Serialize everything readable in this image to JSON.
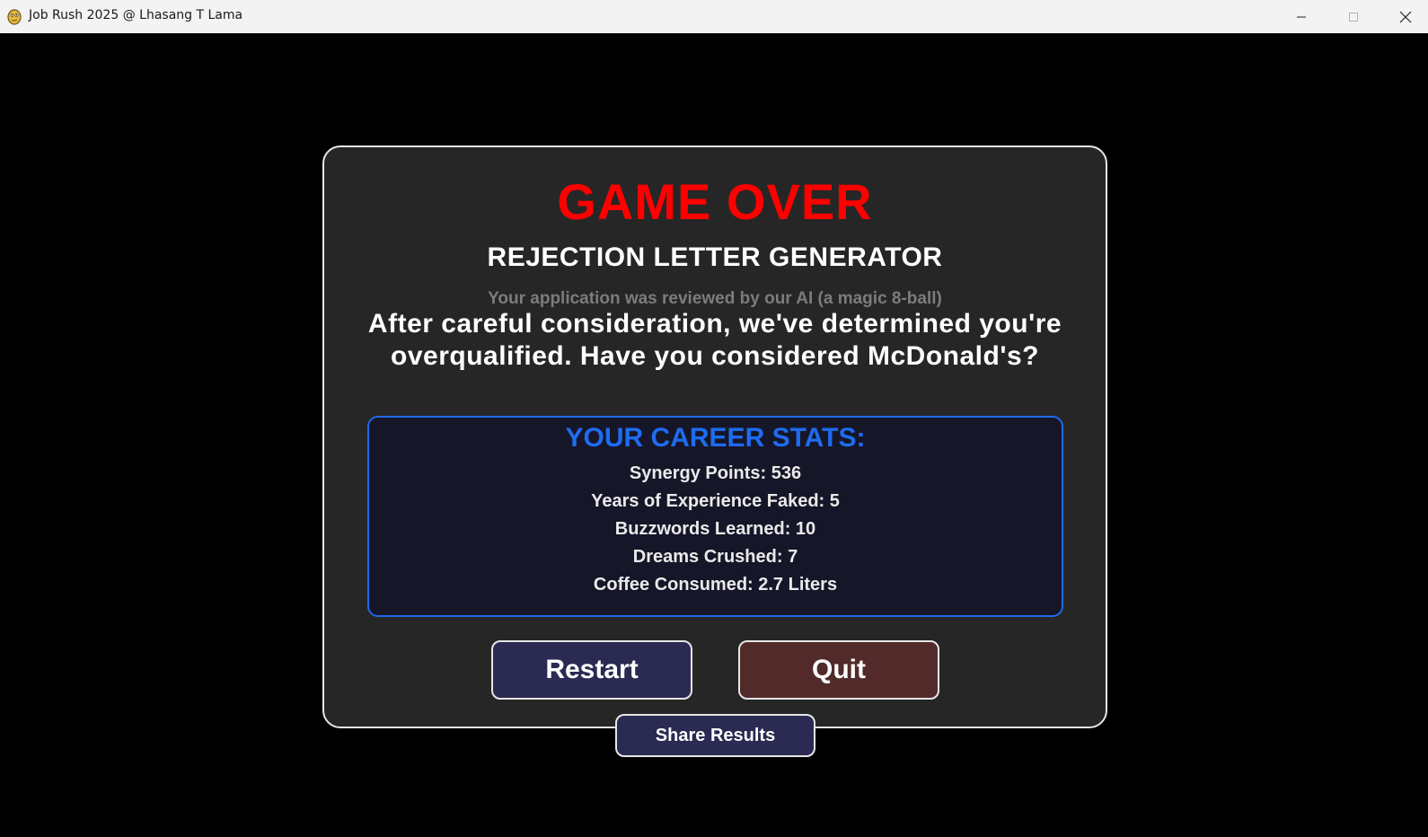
{
  "window": {
    "title": "Job Rush 2025 @ Lhasang T Lama",
    "icon": "pygame-snake-icon"
  },
  "game_over": {
    "heading": "GAME OVER",
    "subtitle": "REJECTION LETTER GENERATOR",
    "reviewed_note": "Your application was reviewed by our AI (a magic 8-ball)",
    "message": "After careful consideration, we've determined you're overqualified. Have you considered McDonald's?"
  },
  "stats": {
    "title": "YOUR CAREER STATS:",
    "lines": [
      "Synergy Points: 536",
      "Years of Experience Faked: 5",
      "Buzzwords Learned: 10",
      "Dreams Crushed: 7",
      "Coffee Consumed: 2.7 Liters"
    ]
  },
  "buttons": {
    "restart": "Restart",
    "quit": "Quit",
    "share": "Share Results"
  },
  "colors": {
    "heading": "#ff0000",
    "stats_title": "#1e6cf0",
    "stats_border": "#1f6ae8",
    "panel_bg": "#262626",
    "restart_bg": "#2a2a52",
    "quit_bg": "#522a2a",
    "muted_text": "#7c7c7c"
  }
}
